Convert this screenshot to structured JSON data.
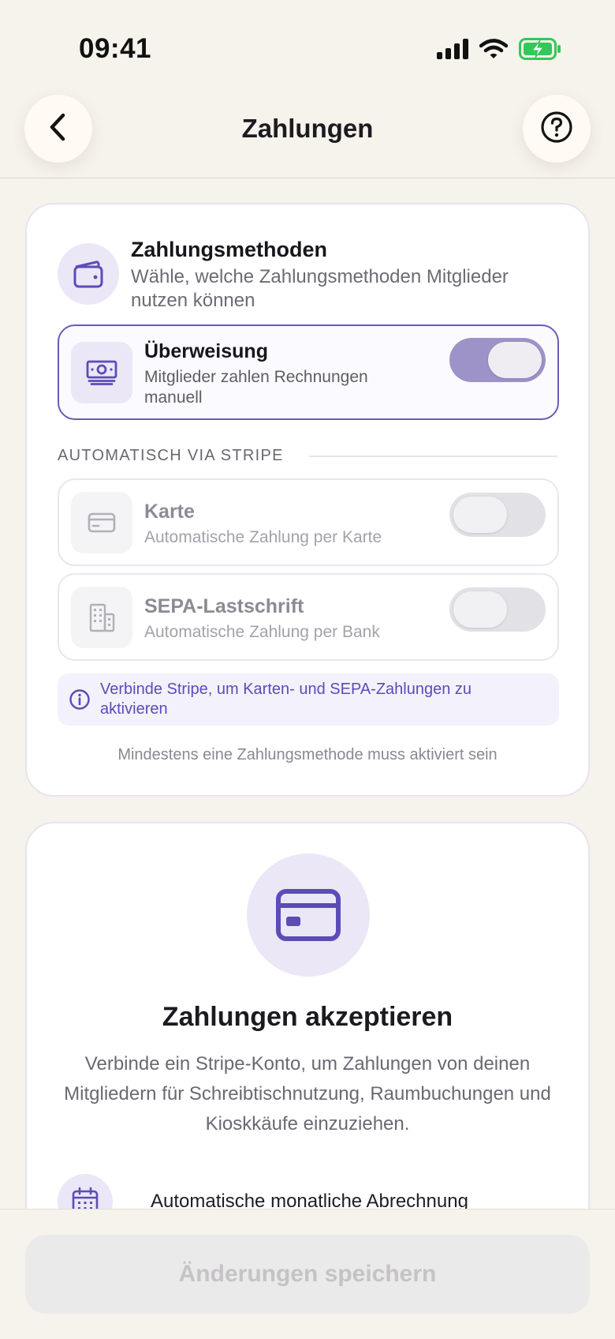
{
  "status_bar": {
    "time": "09:41",
    "icons": [
      "signal-icon",
      "wifi-icon",
      "battery-charging-icon"
    ]
  },
  "header": {
    "title": "Zahlungen",
    "back_icon": "chevron-left-icon",
    "help_icon": "help-circle-icon"
  },
  "payment_methods": {
    "icon": "wallet-icon",
    "title": "Zahlungsmethoden",
    "subtitle": "Wähle, welche Zahlungsmethoden Mitglieder nutzen können",
    "manual": {
      "icon": "banknote-icon",
      "title": "Überweisung",
      "subtitle": "Mitglieder zahlen Rechnungen manuell",
      "enabled": true
    },
    "stripe_section_label": "AUTOMATISCH VIA STRIPE",
    "stripe_methods": [
      {
        "icon": "credit-card-icon",
        "title": "Karte",
        "subtitle": "Automatische Zahlung per Karte",
        "enabled": false
      },
      {
        "icon": "building-icon",
        "title": "SEPA-Lastschrift",
        "subtitle": "Automatische Zahlung per Bank",
        "enabled": false
      }
    ],
    "info_icon": "info-icon",
    "info_text": "Verbinde Stripe, um Karten- und SEPA-Zahlungen zu aktivieren",
    "min_note": "Mindestens eine Zahlungsmethode muss aktiviert sein"
  },
  "accept_payments": {
    "icon": "credit-card-icon",
    "title": "Zahlungen akzeptieren",
    "description": "Verbinde ein Stripe-Konto, um Zahlungen von deinen Mitgliedern für Schreibtischnutzung, Raumbuchungen und Kioskkäufe einzuziehen.",
    "features": [
      {
        "icon": "calendar-icon",
        "label": "Automatische monatliche Abrechnung"
      }
    ]
  },
  "footer": {
    "save_label": "Änderungen speichern",
    "save_enabled": false
  },
  "colors": {
    "background": "#f6f2ec",
    "accent": "#5b4cb8",
    "accent_light": "#ebe7f7",
    "toggle_on": "#9d93c8"
  }
}
